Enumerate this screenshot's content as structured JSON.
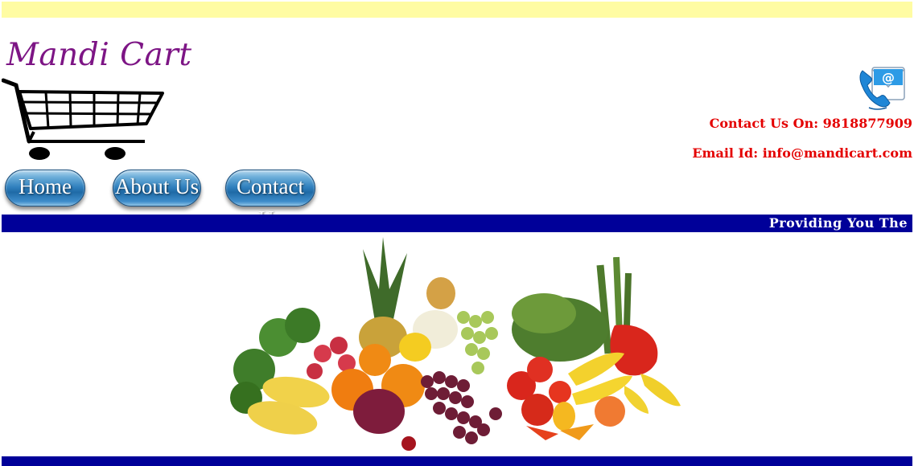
{
  "brand": {
    "name": "Mandi Cart",
    "color": "#7d1585"
  },
  "nav": {
    "items": [
      {
        "label": "Home"
      },
      {
        "label": "About Us"
      },
      {
        "label": "Contact Us"
      }
    ]
  },
  "contact": {
    "phone_text": "Contact Us On: 9818877909",
    "email_text": "Email Id: info@mandicart.com",
    "text_color": "#e40000",
    "icon": "phone-email-icon"
  },
  "marquee": {
    "text": "Providing You The",
    "background": "#000099"
  },
  "colors": {
    "top_strip": "#fffca3",
    "bars": "#000099"
  },
  "hero": {
    "image": "fruits-vegetables-image"
  }
}
